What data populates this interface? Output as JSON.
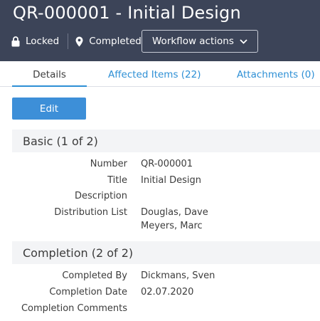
{
  "header": {
    "title": "QR-000001 - Initial Design",
    "lock_label": "Locked",
    "status_label": "Completed",
    "workflow_button": "Workflow actions"
  },
  "tabs": [
    {
      "label": "Details"
    },
    {
      "label": "Affected Items (22)"
    },
    {
      "label": "Attachments (0)"
    }
  ],
  "edit_label": "Edit",
  "sections": [
    {
      "title": "Basic (1 of 2)",
      "fields": [
        {
          "label": "Number",
          "value": "QR-000001"
        },
        {
          "label": "Title",
          "value": "Initial Design"
        },
        {
          "label": "Description",
          "value": ""
        },
        {
          "label": "Distribution List",
          "values": [
            "Douglas, Dave",
            "Meyers, Marc"
          ]
        }
      ]
    },
    {
      "title": "Completion (2 of 2)",
      "fields": [
        {
          "label": "Completed By",
          "value": "Dickmans, Sven"
        },
        {
          "label": "Completion Date",
          "value": "02.07.2020"
        },
        {
          "label": "Completion Comments",
          "value": ""
        }
      ]
    }
  ],
  "colors": {
    "header_bg": "#3c4458",
    "accent": "#2d8fd5",
    "edit_button": "#3d8fd8",
    "section_bg": "#f3f4f6"
  },
  "icons": {
    "lock": "lock-icon",
    "status": "location-pin-icon",
    "dropdown": "chevron-down-icon"
  }
}
